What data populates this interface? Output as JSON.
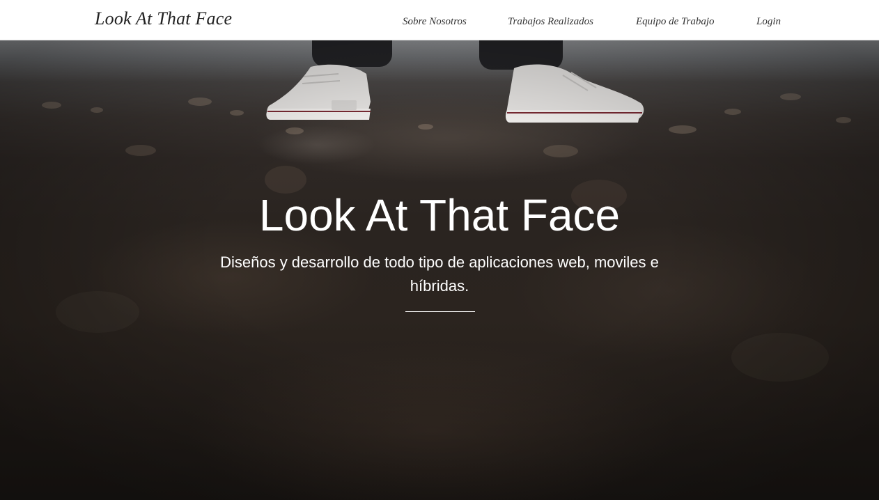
{
  "navbar": {
    "brand": "Look At That Face",
    "links": [
      {
        "label": "Sobre Nosotros"
      },
      {
        "label": "Trabajos Realizados"
      },
      {
        "label": "Equipo de Trabajo"
      },
      {
        "label": "Login"
      }
    ]
  },
  "hero": {
    "title": "Look At That Face",
    "subtitle": "Diseños y desarrollo de todo tipo de aplicaciones web, moviles e híbridas."
  },
  "colors": {
    "navbar_bg": "#ffffff",
    "text_on_hero": "#ffffff",
    "nav_text": "#333333"
  }
}
